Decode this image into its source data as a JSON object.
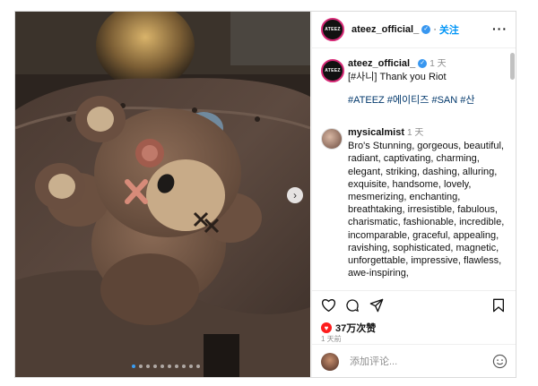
{
  "post": {
    "account": "ateez_official_",
    "avatar_text": "ATEEZ",
    "follow_label": "关注",
    "caption_time": "1 天",
    "caption_line": "[#사니] Thank you Riot",
    "hashtags": "#ATEEZ #에이티즈 #SAN #산"
  },
  "comment": {
    "user": "mysicalmist",
    "time": "1 天",
    "text": "Bro's Stunning, gorgeous, beautiful, radiant, captivating, charming, elegant, striking, dashing, alluring, exquisite, handsome, lovely, mesmerizing, enchanting, breathtaking, irresistible, fabulous, charismatic, fashionable, incredible, incomparable, graceful, appealing, ravishing, sophisticated, magnetic, unforgettable, impressive, flawless, awe-inspiring,"
  },
  "stats": {
    "likes": "37万次赞",
    "ago": "1 天前"
  },
  "add_comment": {
    "placeholder": "添加评论..."
  },
  "icons": {
    "verified": "verified-badge-icon",
    "more": "more-options-icon",
    "like": "heart-icon",
    "comment": "comment-icon",
    "share": "share-icon",
    "save": "bookmark-icon",
    "emoji": "emoji-icon",
    "next": "chevron-right-icon"
  },
  "carousel": {
    "total": 10,
    "current": 1
  },
  "colors": {
    "link": "#0095f6",
    "hashtag": "#00376b",
    "verified": "#3897f0"
  }
}
